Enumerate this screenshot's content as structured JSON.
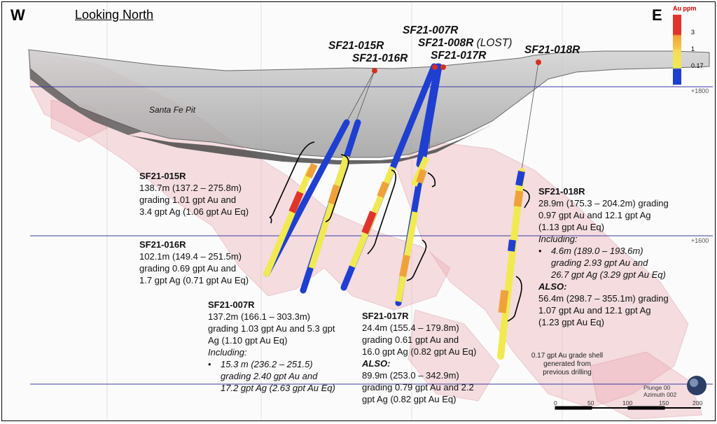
{
  "view": {
    "west_label": "W",
    "east_label": "E",
    "title": "Looking North",
    "pit_label": "Santa Fe Pit",
    "elevations": [
      "+1800",
      "+1600"
    ]
  },
  "legend": {
    "title": "Au ppm",
    "ticks": [
      "3",
      "1",
      "0.17"
    ],
    "colors": {
      "high": "#e0342a",
      "mid_high": "#f0a23a",
      "mid": "#f5c84a",
      "low": "#f0ea50",
      "lowest": "#1f3fd1"
    }
  },
  "holes": {
    "h015": "SF21-015R",
    "h016": "SF21-016R",
    "h007": "SF21-007R",
    "h008": "SF21-008R",
    "h008_note": "(LOST)",
    "h017": "SF21-017R",
    "h018": "SF21-018R"
  },
  "intercepts": {
    "sf015": {
      "title": "SF21-015R",
      "l1": "138.7m (137.2 – 275.8m)",
      "l2": "grading 1.01 gpt Au and",
      "l3": "3.4 gpt Ag (1.06 gpt Au Eq)"
    },
    "sf016": {
      "title": "SF21-016R",
      "l1": "102.1m (149.4 – 251.5m)",
      "l2": "grading 0.69 gpt Au and",
      "l3": "1.7 gpt Ag (0.71 gpt Au Eq)"
    },
    "sf007": {
      "title": "SF21-007R",
      "l1": "137.2m (166.1 – 303.3m)",
      "l2": "grading 1.03 gpt Au and 5.3 gpt",
      "l3": "Ag (1.10 gpt Au Eq)",
      "incl": "Including:",
      "b1": "15.3 m (236.2 – 251.5)",
      "b2": "grading 2.40 gpt Au and",
      "b3": "17.2 gpt Ag (2.63 gpt Au Eq)"
    },
    "sf017": {
      "title": "SF21-017R",
      "l1": "24.4m (155.4 – 179.8m)",
      "l2": "grading 0.61 gpt Au and",
      "l3": "16.0 gpt Ag (0.82 gpt Au Eq)",
      "also": "ALSO:",
      "a1": "89.9m (253.0 – 342.9m)",
      "a2": "grading 0.79 gpt Au and 2.2",
      "a3": "gpt Ag (0.82 gpt Au Eq)"
    },
    "sf018": {
      "title": "SF21-018R",
      "l1": "28.9m (175.3 – 204.2m) grading",
      "l2": "0.97 gpt Au and 12.1 gpt Ag",
      "l3": "(1.13 gpt Au Eq)",
      "incl": "Including:",
      "b1": "4.6m (189.0 – 193.6m)",
      "b2": "grading 2.93 gpt Au and",
      "b3": "26.7 gpt Ag (3.29 gpt Au Eq)",
      "also": "ALSO:",
      "a1": "56.4m (298.7 – 355.1m) grading",
      "a2": "1.07 gpt Au and 12.1 gpt Ag",
      "a3": "(1.23 gpt Au Eq)"
    }
  },
  "shell_note": {
    "l1": "0.17 gpt Au grade shell",
    "l2": "generated from",
    "l3": "previous drilling"
  },
  "orientation": {
    "plunge": "Plunge 00",
    "azimuth": "Azimuth 002"
  },
  "scale": {
    "ticks": [
      "0",
      "50",
      "100",
      "150",
      "200"
    ]
  }
}
